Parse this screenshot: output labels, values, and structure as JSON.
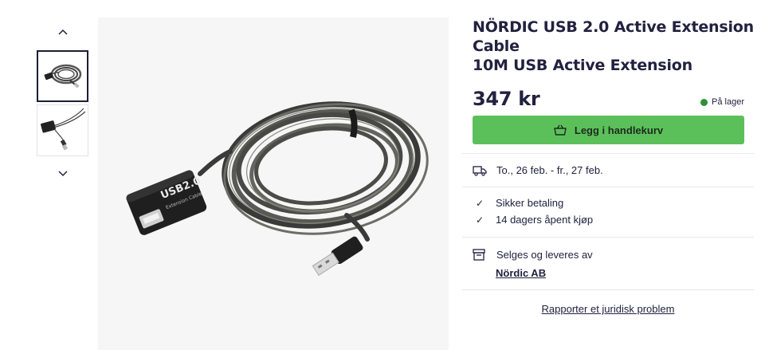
{
  "gallery": {
    "prev_icon": "chevron-up-icon",
    "next_icon": "chevron-down-icon",
    "thumbnails": [
      "usb-cable-coiled-thumbnail",
      "usb-cable-extended-thumbnail"
    ],
    "active_index": 0
  },
  "product": {
    "title_line1": "NÖRDIC USB 2.0 Active Extension Cable",
    "title_line2": "10M USB Active Extension",
    "price": "347 kr",
    "stock": "På lager",
    "stock_color": "#2f8f3a",
    "add_to_cart": "Legg i handlekurv",
    "cart_button_color": "#5cc05a",
    "cable_label": "USB2.0",
    "cable_sublabel": "Extension Cable"
  },
  "delivery": {
    "icon": "truck-icon",
    "text": "To., 26 feb. - fr., 27 feb."
  },
  "benefits": [
    {
      "icon": "check-icon",
      "text": "Sikker betaling"
    },
    {
      "icon": "check-icon",
      "text": "14 dagers åpent kjøp"
    }
  ],
  "seller": {
    "icon": "store-icon",
    "text": "Selges og leveres av",
    "name": "Nördic AB"
  },
  "report": {
    "text": "Rapporter et juridisk problem"
  }
}
